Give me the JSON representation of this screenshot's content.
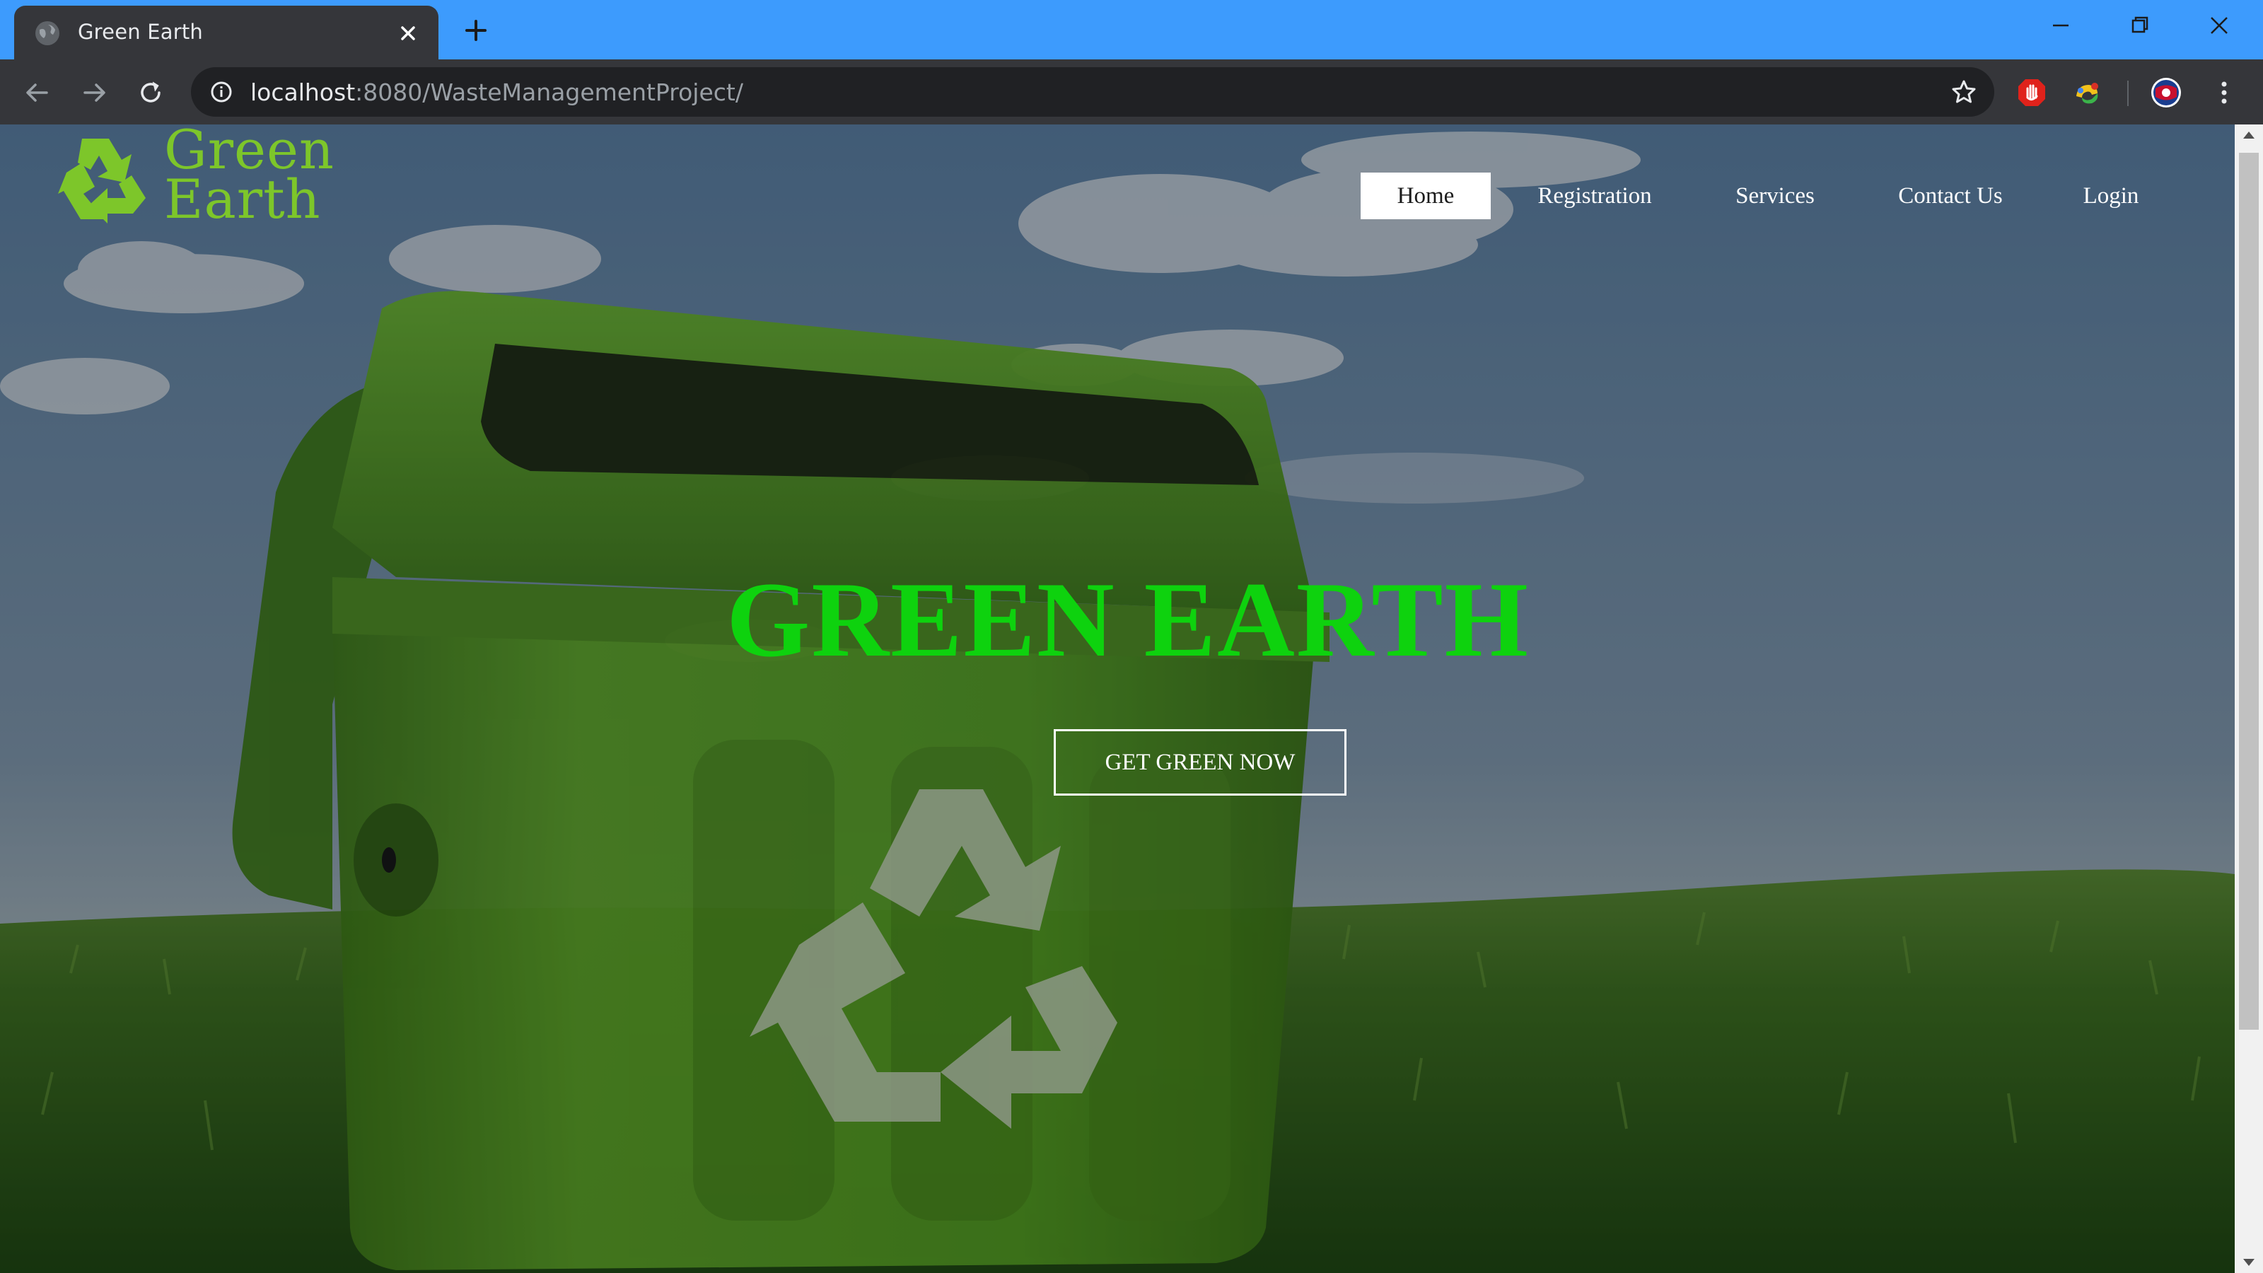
{
  "browser": {
    "tab_title": "Green Earth",
    "url_host": "localhost",
    "url_rest": ":8080/WasteManagementProject/"
  },
  "logo": {
    "line1": "Green",
    "line2": "Earth",
    "color": "#7dc62a"
  },
  "nav": {
    "items": [
      {
        "label": "Home",
        "active": true
      },
      {
        "label": "Registration",
        "active": false
      },
      {
        "label": "Services",
        "active": false
      },
      {
        "label": "Contact Us",
        "active": false
      },
      {
        "label": "Login",
        "active": false
      }
    ]
  },
  "hero": {
    "title": "GREEN EARTH",
    "title_color": "#0ed20e",
    "cta_label": "GET GREEN NOW"
  },
  "icons": {
    "browser": [
      "globe-icon",
      "close-icon",
      "plus-icon",
      "minimize-icon",
      "restore-icon",
      "window-close-icon",
      "back-arrow-icon",
      "forward-arrow-icon",
      "reload-icon",
      "info-icon",
      "star-icon",
      "adblock-icon",
      "extension-icon",
      "profile-avatar-icon",
      "menu-kebab-icon"
    ],
    "page": [
      "recycle-logo-icon",
      "recycle-symbol"
    ]
  }
}
